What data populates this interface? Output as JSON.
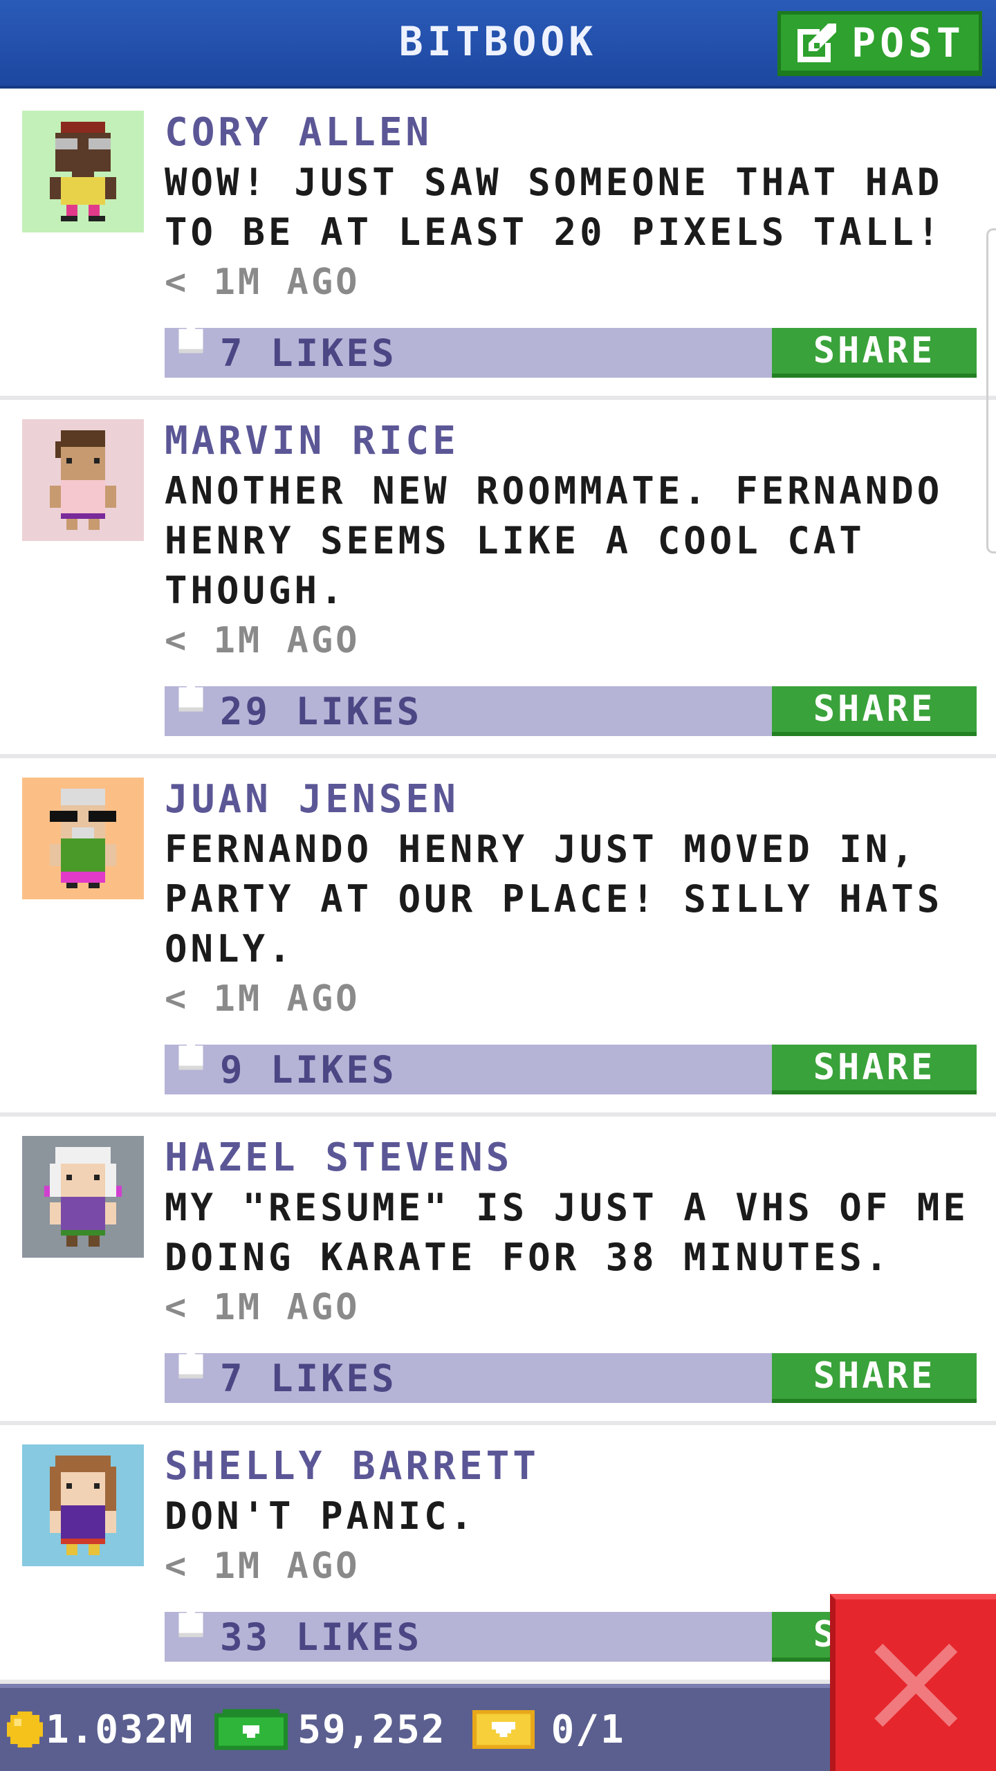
{
  "header": {
    "title": "BITBOOK",
    "post_label": "POST",
    "post_icon": "edit-icon",
    "accent": "#1f4aa3",
    "button_color": "#2ea12e"
  },
  "posts": [
    {
      "author": "CORY ALLEN",
      "message": "WOW! JUST SAW SOMEONE THAT HAD\nTO BE AT LEAST 20 PIXELS TALL!",
      "time": "< 1M AGO",
      "likes": "7 LIKES",
      "share_label": "SHARE",
      "avatar_bg": "#c3f0b8"
    },
    {
      "author": "MARVIN RICE",
      "message": "ANOTHER NEW ROOMMATE. FERNANDO\nHENRY SEEMS LIKE A COOL CAT\nTHOUGH.",
      "time": "< 1M AGO",
      "likes": "29 LIKES",
      "share_label": "SHARE",
      "avatar_bg": "#ecd2d6"
    },
    {
      "author": "JUAN JENSEN",
      "message": "FERNANDO HENRY JUST MOVED IN,\nPARTY AT OUR PLACE! SILLY HATS\nONLY.",
      "time": "< 1M AGO",
      "likes": "9 LIKES",
      "share_label": "SHARE",
      "avatar_bg": "#fbbf86"
    },
    {
      "author": "HAZEL STEVENS",
      "message": "MY \"RESUME\" IS JUST A VHS OF ME\nDOING KARATE FOR 38 MINUTES.",
      "time": "< 1M AGO",
      "likes": "7 LIKES",
      "share_label": "SHARE",
      "avatar_bg": "#8c949c"
    },
    {
      "author": "SHELLY BARRETT",
      "message": "DON'T PANIC.",
      "time": "< 1M AGO",
      "likes": "33 LIKES",
      "share_label": "SHARE",
      "avatar_bg": "#86c9e0"
    }
  ],
  "status_bar": {
    "coins": "1.032M",
    "bux": "59,252",
    "tickets": "0/1"
  }
}
